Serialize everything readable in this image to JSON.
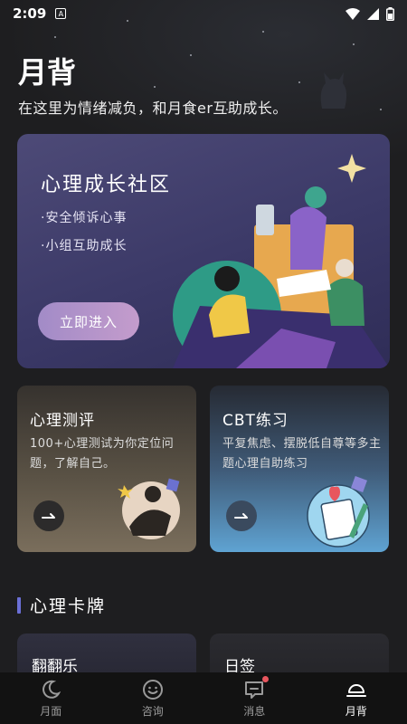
{
  "status": {
    "time": "2:09"
  },
  "header": {
    "title": "月背",
    "subtitle": "在这里为情绪减负，和月食er互助成长。"
  },
  "community": {
    "title": "心理成长社区",
    "items": [
      "·安全倾诉心事",
      "·小组互助成长"
    ],
    "button": "立即进入"
  },
  "cards": [
    {
      "title": "心理测评",
      "desc": "100+心理测试为你定位问题，了解自己。"
    },
    {
      "title": "CBT练习",
      "desc": "平复焦虑、摆脱低自尊等多主题心理自助练习"
    }
  ],
  "section": {
    "title": "心理卡牌"
  },
  "mini_cards": [
    "翻翻乐",
    "日签"
  ],
  "tabs": [
    {
      "label": "月面",
      "icon": "moon-icon"
    },
    {
      "label": "咨询",
      "icon": "smile-icon"
    },
    {
      "label": "消息",
      "icon": "message-icon"
    },
    {
      "label": "月背",
      "icon": "bell-dome-icon"
    }
  ],
  "colors": {
    "accent": "#6b6fd6",
    "badge": "#e8565e",
    "button": "#b394c9"
  }
}
